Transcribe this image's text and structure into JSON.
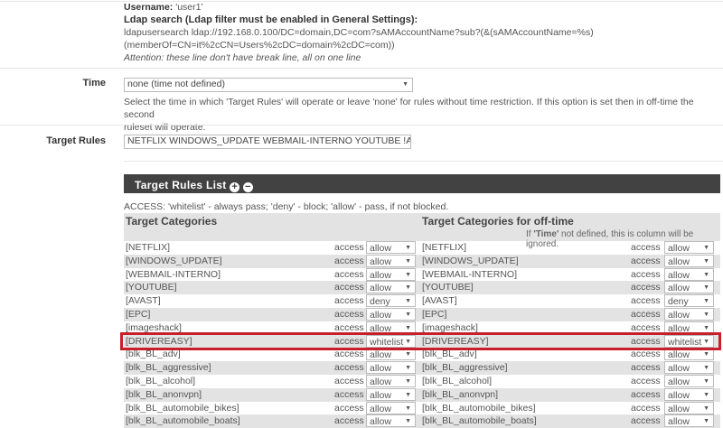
{
  "info": {
    "username_label": "Username:",
    "username_value": "'user1'",
    "ldap_title": "Ldap search (Ldap filter must be enabled in General Settings):",
    "ldap_line1": "ldapusersearch ldap://192.168.0.100/DC=domain,DC=com?sAMAccountName?sub?(&(sAMAccountName=%s)",
    "ldap_line2": "(memberOf=CN=it%2cCN=Users%2cDC=domain%2cDC=com))",
    "attention": "Attention: these line don't have break line, all on one line"
  },
  "time": {
    "label": "Time",
    "value": "none (time not defined)",
    "help_1": "Select the time in which 'Target Rules' will operate or leave 'none' for rules without time restriction. If this option is set then in off-time the second",
    "help_2": "ruleset will operate."
  },
  "target_rules": {
    "label": "Target Rules",
    "value": "NETFLIX WINDOWS_UPDATE WEBMAIL-INTERNO YOUTUBE !AVAST EPC"
  },
  "list": {
    "title": "Target Rules List",
    "access_note": "ACCESS: 'whitelist' - always pass; 'deny' - block; 'allow' - pass, if not blocked.",
    "col1": "Target Categories",
    "col2": "Target Categories for off-time",
    "col2_note_pre": "If ",
    "col2_note_bold": "'Time'",
    "col2_note_post": " not defined, this is column will be ignored.",
    "access_word": "access",
    "rows": [
      {
        "name": "[NETFLIX]",
        "access": "allow",
        "off": "allow"
      },
      {
        "name": "[WINDOWS_UPDATE]",
        "access": "allow",
        "off": "allow"
      },
      {
        "name": "[WEBMAIL-INTERNO]",
        "access": "allow",
        "off": "allow"
      },
      {
        "name": "[YOUTUBE]",
        "access": "allow",
        "off": "allow"
      },
      {
        "name": "[AVAST]",
        "access": "deny",
        "off": "deny"
      },
      {
        "name": "[EPC]",
        "access": "allow",
        "off": "allow"
      },
      {
        "name": "[imageshack]",
        "access": "allow",
        "off": "allow"
      },
      {
        "name": "[DRIVEREASY]",
        "access": "whitelist",
        "off": "whitelist"
      },
      {
        "name": "[blk_BL_adv]",
        "access": "allow",
        "off": "allow"
      },
      {
        "name": "[blk_BL_aggressive]",
        "access": "allow",
        "off": "allow"
      },
      {
        "name": "[blk_BL_alcohol]",
        "access": "allow",
        "off": "allow"
      },
      {
        "name": "[blk_BL_anonvpn]",
        "access": "allow",
        "off": "allow"
      },
      {
        "name": "[blk_BL_automobile_bikes]",
        "access": "allow",
        "off": "allow"
      },
      {
        "name": "[blk_BL_automobile_boats]",
        "access": "allow",
        "off": "allow"
      }
    ]
  },
  "colors": {
    "header_bar": "#424242",
    "highlight": "#c8202a"
  }
}
